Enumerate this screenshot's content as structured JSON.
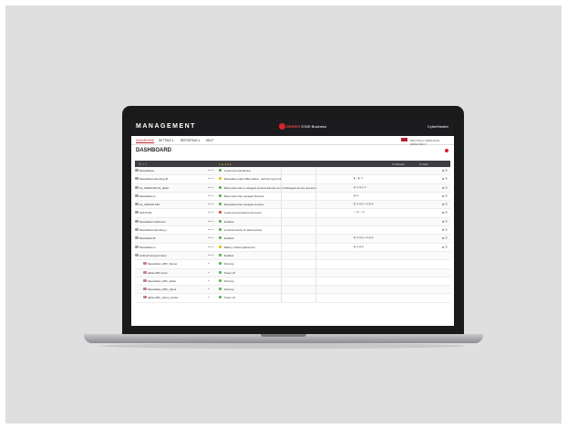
{
  "header": {
    "app_title": "MANAGEMENT",
    "brand_name": "DRIVEN",
    "brand_suffix": "STAR Business",
    "user": "Cybertheater"
  },
  "menu": {
    "items": [
      "DASHBOARD",
      "SETTING ▾",
      "REPORTING ▾",
      "HELP"
    ],
    "active_index": 0,
    "right_text": "DEUTSCH / ENGLISCH (ENGLISH) ▾"
  },
  "page": {
    "title": "DASHBOARD"
  },
  "table": {
    "headers": {
      "name": "☰ ⤢ ⤡",
      "status": "● ▲ ● ● ●",
      "right1": "⟳ Refresh",
      "right2": "⇅ Filter"
    },
    "rows": [
      {
        "name": "Messtablets",
        "badges": "●● ▲",
        "status": "Local mine and Service",
        "status_color": "#4caf50",
        "meta": "",
        "action": "⚙ ☰",
        "sub": false
      },
      {
        "name": "Messtablet-Hamburg-B",
        "badges": "●● ▲",
        "status": "Messtablet online Mittel Status - last link report info",
        "status_color": "#f0b400",
        "meta": "◧ - ◧ ⚙",
        "action": "⚙ ☰",
        "sub": false
      },
      {
        "name": "10_ANDROID-15_tablet",
        "badges": "●● ▲",
        "status": "Below also hole in managed services Remote Control Managed service and active",
        "status_color": "#4caf50",
        "meta": "◧ ▤  ▮ ▤  ⚙",
        "action": "⚙ ☰",
        "sub": false
      },
      {
        "name": "Messtablet-A",
        "badges": "●● ▲",
        "status": "Below also hole managed Services",
        "status_color": "#4caf50",
        "meta": "◧ ▤",
        "action": "⚙ ☰",
        "sub": false
      },
      {
        "name": "10_ANDOR-128",
        "badges": "●● ▲",
        "status": "Messtablet hole managed services",
        "status_color": "#4caf50",
        "meta": "◧ ▤  ▮ ▤  ● ▤  ▮ ▤",
        "action": "⚙ ☰",
        "sub": false
      },
      {
        "name": "SOLTOOL",
        "badges": "●● ▲",
        "status": "Local communications few hours",
        "status_color": "#e53935",
        "meta": "▢ ▤  ▢ ▤",
        "action": "⚙ ☰",
        "sub": false
      },
      {
        "name": "Messtablet-Cabinets-I",
        "badges": "●● ▲",
        "status": "Enabled",
        "status_color": "#4caf50",
        "meta": "",
        "action": "⚙ ☰",
        "sub": false
      },
      {
        "name": "Messtablet-Hamburg-I",
        "badges": "●● ▲",
        "status": "Local list activity for latest activity",
        "status_color": "#4caf50",
        "meta": "",
        "action": "⚙ ☰",
        "sub": false
      },
      {
        "name": "Messtablet-B",
        "badges": "●● ▲",
        "status": "Enabled",
        "status_color": "#4caf50",
        "meta": "◧ ▤  ▮ ▤  ● ▤  ▮ ▤",
        "action": "⚙ ☰",
        "sub": false
      },
      {
        "name": "Messtablet-C",
        "badges": "●● ▲",
        "status": "Battery critical replacement",
        "status_color": "#f0b400",
        "meta": "◧ ▤  ▮ ▤",
        "action": "⚙ ☰",
        "sub": false
      },
      {
        "name": "Android-Gruppenraum",
        "badges": "●● ▲",
        "status": "Enabled",
        "status_color": "#4caf50",
        "meta": "",
        "action": "",
        "sub": false
      },
      {
        "name": "Messtablet_ZDF_Server",
        "badges": "●",
        "status": "Running",
        "status_color": "#4caf50",
        "meta": "",
        "action": "",
        "sub": true
      },
      {
        "name": "tablet-ZDF-Kran",
        "badges": "●",
        "status": "Power off",
        "status_color": "#4caf50",
        "meta": "",
        "action": "",
        "sub": true
      },
      {
        "name": "Messtablet_ZDF_tablet",
        "badges": "●",
        "status": "Running",
        "status_color": "#4caf50",
        "meta": "",
        "action": "",
        "sub": true
      },
      {
        "name": "Messtablet_ZDF_Client",
        "badges": "●",
        "status": "Running",
        "status_color": "#4caf50",
        "meta": "",
        "action": "",
        "sub": true
      },
      {
        "name": "tablet-ZDF_Client_Archiv",
        "badges": "●",
        "status": "Power off",
        "status_color": "#4caf50",
        "meta": "",
        "action": "",
        "sub": true
      }
    ]
  },
  "colors": {
    "accent": "#c0282e",
    "topbar": "#1c1c1f",
    "ok": "#4caf50",
    "warn": "#f0b400",
    "error": "#e53935"
  }
}
